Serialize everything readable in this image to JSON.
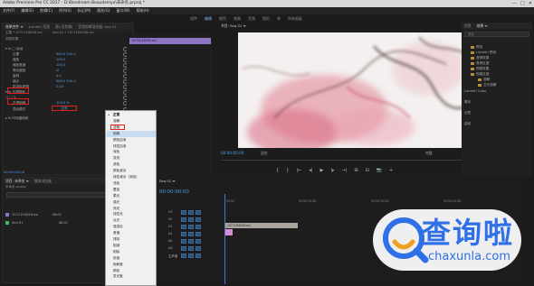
{
  "app": {
    "title": "Adobe Premiere Pro CC 2017 - D:\\Bendream Beaudemyo\\未命名.prproj *",
    "window_buttons": [
      "—",
      "□",
      "✕"
    ]
  },
  "menu": [
    "文件(F)",
    "编辑(E)",
    "剪辑(C)",
    "序列(S)",
    "标记(M)",
    "图形(G)",
    "窗口(W)",
    "帮助(H)"
  ],
  "workspaces": [
    "组件",
    "编辑",
    "颜色",
    "效果",
    "音频",
    "图形",
    "库",
    "所有面板"
  ],
  "effect_controls": {
    "tabs": [
      "效果控件 ≡",
      "Lumetri 范围",
      "源:(无剪辑)",
      "音频剪辑混合器: Seq 01"
    ],
    "source_line": "主要 * 1571154056.avi",
    "sequence_line": "Seq 01 * 1571154056.avi",
    "section": "视频效果",
    "rows": [
      {
        "label": "▾ fx ▢ 运动",
        "value": ""
      },
      {
        "label": "位置",
        "value": "960.0   540.0"
      },
      {
        "label": "缩放",
        "value": "100.0"
      },
      {
        "label": "缩放宽度",
        "value": "100.0"
      },
      {
        "label": "等比缩放",
        "value": "☑"
      },
      {
        "label": "旋转",
        "value": "0.0"
      },
      {
        "label": "锚点",
        "value": "960.0   540.0"
      },
      {
        "label": "防闪烁滤镜",
        "value": "0.00"
      },
      {
        "label": "▾ fx 不透明度",
        "value": ""
      },
      {
        "label": "○ □ ✎",
        "value": ""
      },
      {
        "label": "不透明度",
        "value": "100.0 %"
      },
      {
        "label": "混合模式",
        "value": "正常"
      },
      {
        "label": "▸ fx 时间重映射",
        "value": ""
      }
    ],
    "clip_name": "1571154056.avi",
    "blend_mode_value": "正常",
    "footer_timecode": "00:00:00:00"
  },
  "program_monitor": {
    "title": "节目: Seq 01 ≡",
    "timecode_current": "00:00:00:00",
    "timecode_duration": "00:00:48:01",
    "fit": "适合",
    "resolution": "完整",
    "transport": [
      "{",
      "}",
      "|←",
      "◂|",
      "▶",
      "|▸",
      "→|",
      "⊞",
      "⊟",
      "📷",
      "+"
    ]
  },
  "project_panel": {
    "tabs": [
      "项目: 未命名 ≡",
      "媒体浏览器"
    ],
    "title": "未命名.prproj",
    "items": [
      {
        "name": "1571154056.avi",
        "info": "48:01",
        "color": "#8d74c4"
      },
      {
        "name": "Seq 01",
        "info": "48:01",
        "color": "#4fae6a"
      }
    ]
  },
  "timeline": {
    "title": "Seq 01 ≡",
    "timecode": "00:00:00:00",
    "tracks": [
      "V3",
      "V2",
      "V1",
      "A1",
      "A2",
      "A3",
      "主声道"
    ],
    "clip_video": "1571154056.avi",
    "ruler_times": [
      "00:00",
      "00:00:15:00",
      "00:00:30:00",
      "00:00:45:00"
    ]
  },
  "context_menu": {
    "items": [
      "正常",
      "溶解",
      "变暗",
      "相乘",
      "颜色加深",
      "线性加深",
      "深色",
      "变亮",
      "滤色",
      "颜色减淡",
      "线性减淡（添加）",
      "浅色",
      "叠加",
      "柔光",
      "强光",
      "亮光",
      "线性光",
      "点光",
      "强混合",
      "差值",
      "排除",
      "相减",
      "相除",
      "色相",
      "饱和度",
      "颜色",
      "发光度"
    ],
    "highlighted": "相乘"
  },
  "right_panel": {
    "tabs": [
      "信息",
      "效果 ≡"
    ],
    "search_placeholder": "搜索",
    "tree": [
      "预设",
      "Lumetri 预设",
      "音频效果",
      "音频过渡",
      "视频效果",
      "视频过渡",
      "溶解",
      "交叉溶解"
    ],
    "sections": [
      "Lumetri Color",
      "基本",
      "创意",
      "曲线"
    ]
  },
  "watermark": {
    "brand": "查询啦",
    "url": "chaxunla.com"
  },
  "colors": {
    "accent_blue": "#4f9ee8",
    "clip_purple": "#8d74c4",
    "highlight_red": "#e02020",
    "watermark_blue": "#2f6fe8"
  }
}
